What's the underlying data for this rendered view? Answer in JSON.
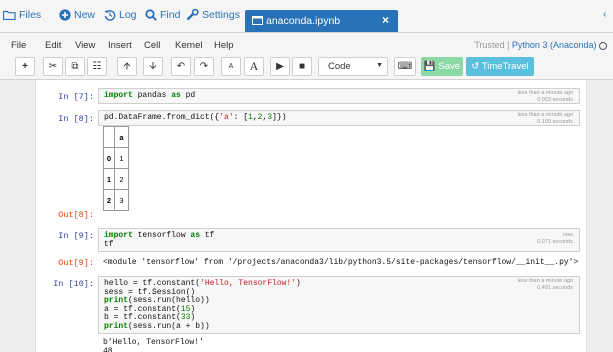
{
  "topbar": {
    "links": [
      {
        "label": "Files",
        "icon": "folder-icon"
      },
      {
        "label": "New",
        "icon": "plus-circle-icon"
      },
      {
        "label": "Log",
        "icon": "history-icon"
      },
      {
        "label": "Find",
        "icon": "search-icon"
      },
      {
        "label": "Settings",
        "icon": "wrench-icon"
      }
    ],
    "tab": {
      "label": "anaconda.ipynb",
      "icon": "notebook-icon",
      "close": "×"
    }
  },
  "menubar": {
    "items": [
      "File",
      "Edit",
      "View",
      "Insert",
      "Cell",
      "Kernel",
      "Help"
    ],
    "trusted": "Trusted",
    "kernel": "Python 3 (Anaconda)"
  },
  "toolbar": {
    "cell_type": "Code",
    "save_label": "Save",
    "timetravel_label": "TimeTravel"
  },
  "cells": [
    {
      "in_prompt": "In [7]:",
      "code": "import pandas as pd",
      "meta": [
        "less than a minute ago",
        "0.003 seconds"
      ]
    },
    {
      "in_prompt": "In [8]:",
      "code": "pd.DataFrame.from_dict({'a': [1,2,3]})",
      "meta": [
        "less than a minute ago",
        "0.109 seconds"
      ],
      "out_prompt": "Out[8]:",
      "table": {
        "header": [
          "",
          "a"
        ],
        "rows": [
          [
            "0",
            "1"
          ],
          [
            "1",
            "2"
          ],
          [
            "2",
            "3"
          ]
        ]
      }
    },
    {
      "in_prompt": "In [9]:",
      "code": "import tensorflow as tf\ntf",
      "meta": [
        "now",
        "0.071 seconds"
      ],
      "out_prompt": "Out[9]:",
      "output": "<module 'tensorflow' from '/projects/anaconda3/lib/python3.5/site-packages/tensorflow/__init__.py'>"
    },
    {
      "in_prompt": "In [10]:",
      "code": "hello = tf.constant('Hello, TensorFlow!')\nsess = tf.Session()\nprint(sess.run(hello))\na = tf.constant(15)\nb = tf.constant(33)\nprint(sess.run(a + b))",
      "meta": [
        "less than a minute ago",
        "0.491 seconds"
      ],
      "output": "b'Hello, TensorFlow!'\n48"
    }
  ]
}
